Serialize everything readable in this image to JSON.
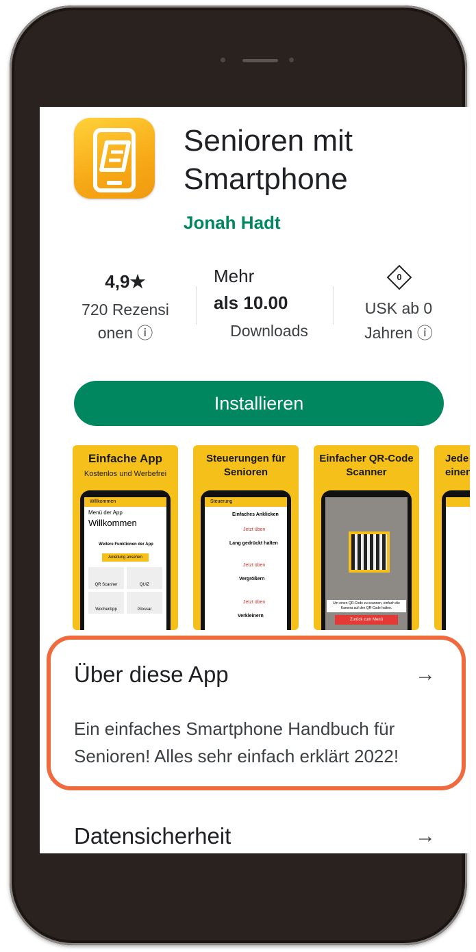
{
  "app": {
    "title": "Senioren mit Smartphone",
    "developer": "Jonah Hadt"
  },
  "stats": {
    "rating": "4,9★",
    "reviews": "720 Rezensi onen ⓘ",
    "downloads_line1": "Mehr",
    "downloads_line2": "als 10.00",
    "downloads_line3": "Downloads",
    "usk_badge": "0",
    "usk": "USK ab 0 Jahren ⓘ"
  },
  "install_label": "Installieren",
  "screenshots": [
    {
      "caption": "Einfache App",
      "sub": "Kostenlos und Werbefrei",
      "bar": "Willkommen",
      "line1": "Menü der App",
      "line2": "Willkommen",
      "line3": "Weitere Funktionen der App",
      "btn": "Anleitung ansehen",
      "grid": [
        "QR Scanner",
        "QUIZ",
        "Wochentipp",
        "Glossar"
      ]
    },
    {
      "caption": "Steuerungen für Senioren",
      "bar": "Steuerung",
      "items": [
        "Einfaches Anklicken",
        "Lang gedrückt halten",
        "Vergrößern",
        "Verkleinern"
      ],
      "action": "Jetzt üben"
    },
    {
      "caption": "Einfacher QR-Code Scanner",
      "hint": "Um einen QR-Code zu scannen, einfach die Kamera auf den QR-Code halten.",
      "back": "Zurück zum Menü"
    },
    {
      "caption": "Jede einen"
    }
  ],
  "about": {
    "title": "Über diese App",
    "description": "Ein einfaches Smartphone Handbuch für Senioren! Alles sehr einfach erklärt 2022!"
  },
  "data_safety": {
    "title": "Datensicherheit"
  },
  "icons": {
    "arrow": "→"
  },
  "colors": {
    "brand": "#01875f",
    "highlight": "#ef6a3d",
    "app_icon": "#f7a916"
  }
}
